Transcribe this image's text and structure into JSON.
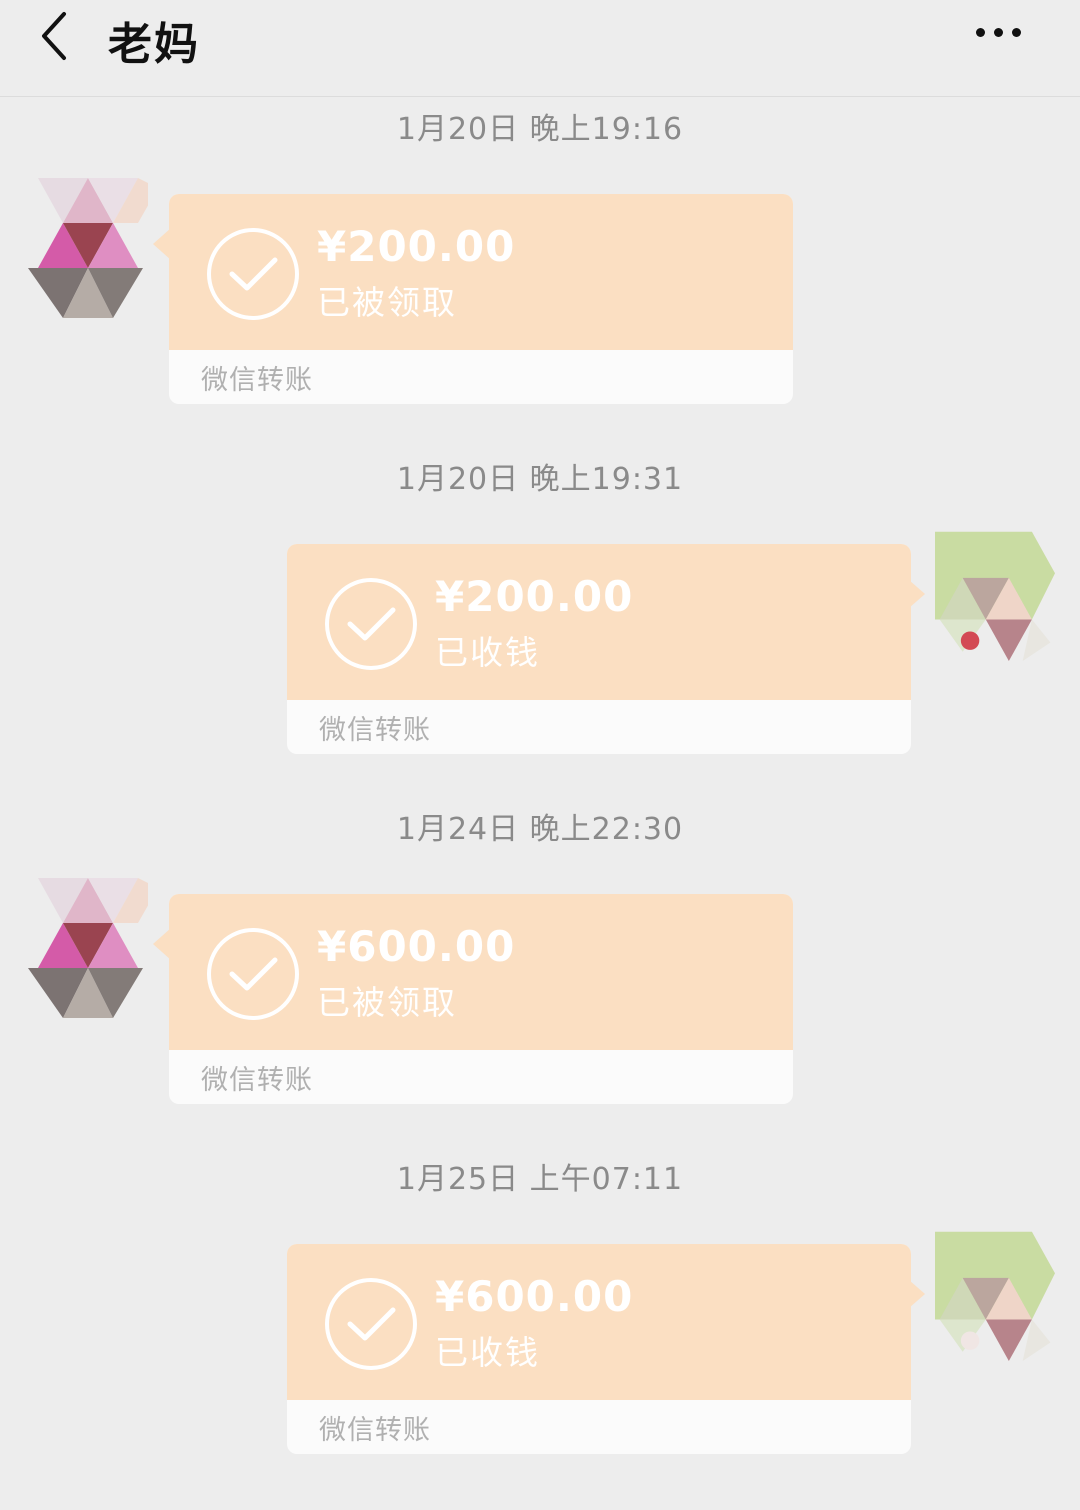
{
  "header": {
    "title": "老妈"
  },
  "messages": [
    {
      "timestamp": "1月20日 晚上19:16",
      "side": "left",
      "amount": "¥200.00",
      "status": "已被领取",
      "footer": "微信转账"
    },
    {
      "timestamp": "1月20日 晚上19:31",
      "side": "right",
      "amount": "¥200.00",
      "status": "已收钱",
      "footer": "微信转账"
    },
    {
      "timestamp": "1月24日 晚上22:30",
      "side": "left",
      "amount": "¥600.00",
      "status": "已被领取",
      "footer": "微信转账"
    },
    {
      "timestamp": "1月25日 上午07:11",
      "side": "right",
      "amount": "¥600.00",
      "status": "已收钱",
      "footer": "微信转账"
    }
  ],
  "colors": {
    "background": "#ededed",
    "transfer_bubble": "#fbdfc2",
    "footer_bg": "#fbfbfb"
  },
  "icons": {
    "back": "chevron-left-icon",
    "more": "more-dots-icon",
    "check": "check-circle-icon"
  }
}
